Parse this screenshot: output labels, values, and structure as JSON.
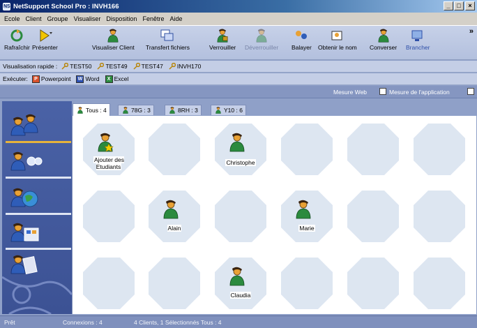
{
  "window": {
    "title": "NetSupport School Pro : INVH166",
    "app_icon": "NS",
    "minimize": "_",
    "maximize": "□",
    "close": "×"
  },
  "menu": [
    "Ecole",
    "Client",
    "Groupe",
    "Visualiser",
    "Disposition",
    "Fenêtre",
    "Aide"
  ],
  "toolbar": {
    "refresh": "Rafraîchir",
    "present": "Présenter",
    "view_client": "Visualiser Client",
    "transfer_files": "Transfert fichiers",
    "lock": "Verrouiller",
    "unlock": "Déverrouiller",
    "scan": "Balayer",
    "get_name": "Obtenir le nom",
    "chat": "Converser",
    "connect": "Brancher",
    "more": "»"
  },
  "quick_view": {
    "label": "Visualisation rapide :",
    "items": [
      "TEST50",
      "TEST49",
      "TEST47",
      "INVH170"
    ]
  },
  "run": {
    "label": "Exécuter:",
    "items": [
      {
        "name": "Powerpoint",
        "badge": "P",
        "color": "#d9512b"
      },
      {
        "name": "Word",
        "badge": "W",
        "color": "#2b4fb0"
      },
      {
        "name": "Excel",
        "badge": "X",
        "color": "#2b8a3e"
      }
    ]
  },
  "measure": {
    "web": "Mesure Web",
    "app": "Mesure de l'application"
  },
  "tabs": [
    "Tous : 4",
    "78G : 3",
    "8RH : 3",
    "Y10 : 6"
  ],
  "students": {
    "add": "Ajouter des Etudiants",
    "names": [
      "Christophe",
      "Alain",
      "Marie",
      "Claudia"
    ]
  },
  "status": {
    "state": "Prêt",
    "connections": "Connexions : 4",
    "summary": "4 Clients, 1 Sélectionnés  Tous : 4"
  },
  "colors": {
    "titlebar": "#0a246a",
    "accent": "#3c5294",
    "tile": "#dde6f1",
    "student_shirt": "#2b8a3e",
    "student_face": "#e8a135"
  },
  "icons": {
    "refresh": "refresh-icon",
    "present": "present-icon",
    "view_client": "view-client-icon",
    "transfer": "transfer-files-icon",
    "lock": "lock-icon",
    "unlock": "unlock-icon",
    "scan": "scan-icon",
    "get_name": "get-name-icon",
    "chat": "chat-icon",
    "connect": "connect-icon",
    "quick_view_key": "key-icon",
    "student": "student-icon"
  }
}
